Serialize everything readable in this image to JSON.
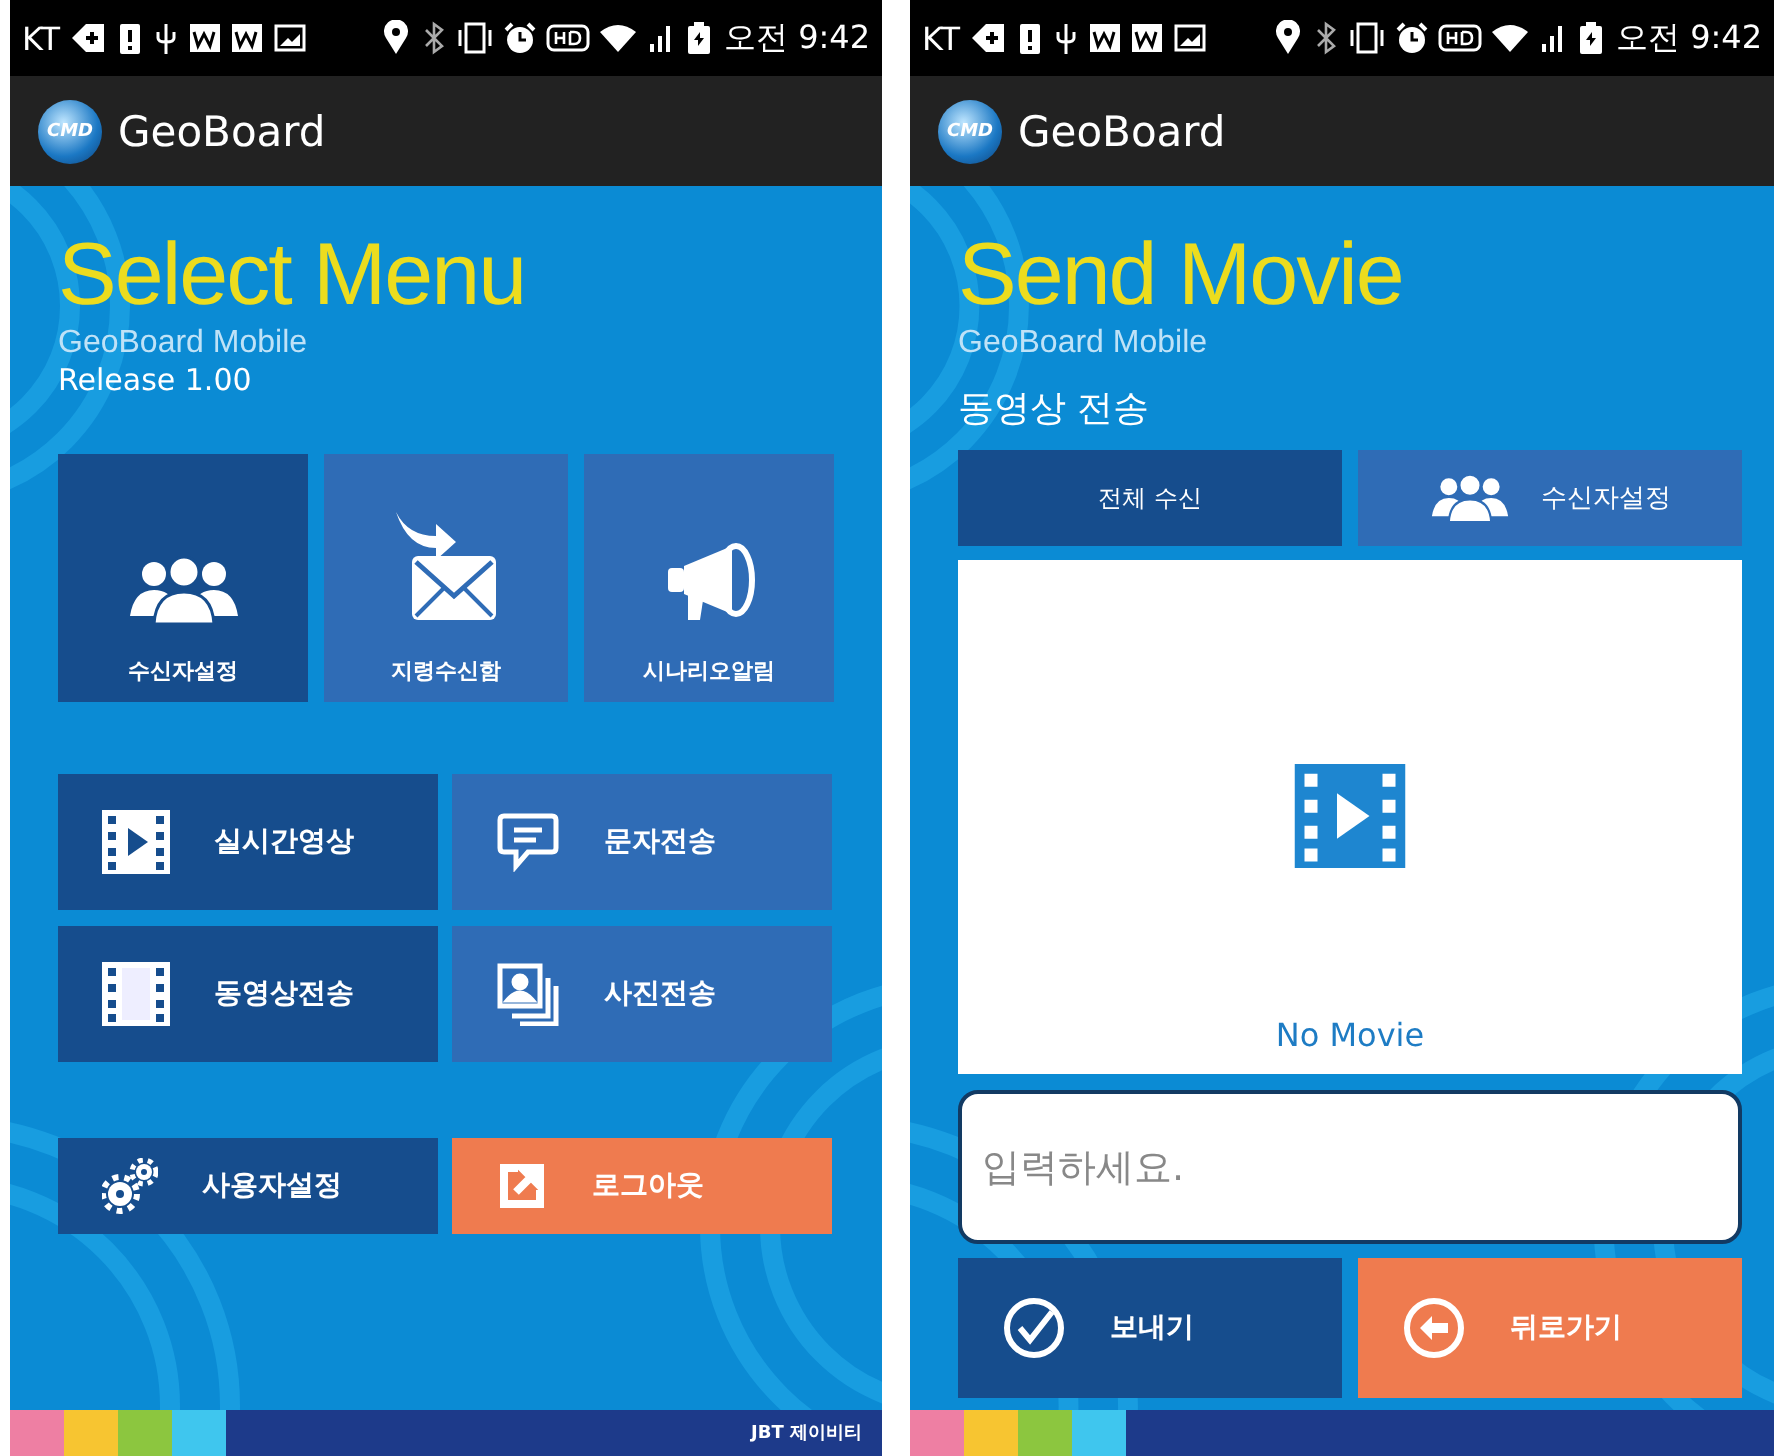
{
  "screens": [
    {
      "kind": "menu",
      "status_bar": {
        "carrier": "KT",
        "time": "오전 9:42"
      },
      "app_bar": {
        "logo": "CMD",
        "title": "GeoBoard"
      },
      "title": "Select Menu",
      "subtitle": "GeoBoard Mobile",
      "release": "Release 1.00",
      "tiles": [
        {
          "label": "수신자설정",
          "color": "#164d8d"
        },
        {
          "label": "지령수신함",
          "color": "#2f6cb6"
        },
        {
          "label": "시나리오알림",
          "color": "#2f6cb6"
        }
      ],
      "buttons": [
        {
          "label": "실시간영상",
          "color": "#164d8d"
        },
        {
          "label": "문자전송",
          "color": "#2f6cb6"
        },
        {
          "label": "동영상전송",
          "color": "#164d8d"
        },
        {
          "label": "사진전송",
          "color": "#2f6cb6"
        }
      ],
      "actions": [
        {
          "label": "사용자설정",
          "color": "#164d8d"
        },
        {
          "label": "로그아웃",
          "color": "#ef7b4f"
        }
      ],
      "footer": {
        "brand": "JBT 제이비티"
      }
    },
    {
      "kind": "send",
      "status_bar": {
        "carrier": "KT",
        "time": "오전 9:42"
      },
      "app_bar": {
        "logo": "CMD",
        "title": "GeoBoard"
      },
      "title": "Send Movie",
      "subtitle": "GeoBoard Mobile",
      "section": "동영상 전송",
      "tabs": [
        {
          "label": "전체 수신",
          "selected": true
        },
        {
          "label": "수신자설정",
          "selected": false
        }
      ],
      "preview": {
        "caption": "No Movie"
      },
      "message": {
        "placeholder": "입력하세요."
      },
      "actions": [
        {
          "label": "보내기",
          "color": "#164d8d"
        },
        {
          "label": "뒤로가기",
          "color": "#ef7b4f"
        }
      ]
    }
  ]
}
